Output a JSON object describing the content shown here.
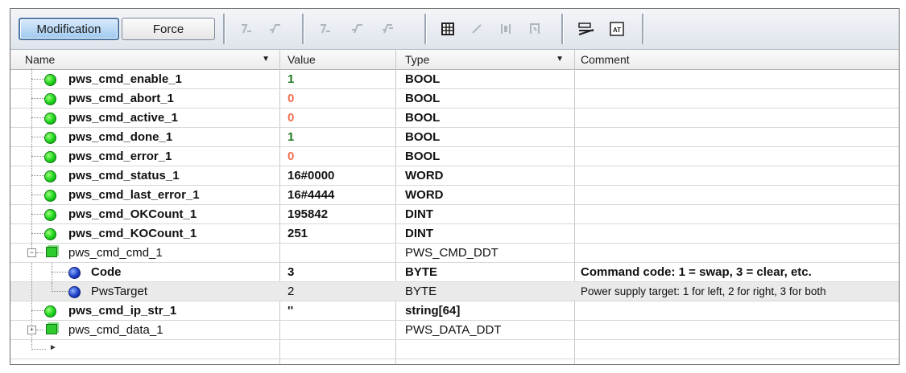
{
  "toolbar": {
    "modification_label": "Modification",
    "force_label": "Force",
    "icons": [
      "force-rising-icon",
      "force-falling-icon",
      "unforce-rising-icon",
      "unforce-falling-icon",
      "unforce-all-icon",
      "grid-icon",
      "slash-icon",
      "bracket-icon",
      "ladder-icon",
      "edit-line-icon",
      "at-icon"
    ]
  },
  "columns": {
    "name": "Name",
    "value": "Value",
    "type": "Type",
    "comment": "Comment"
  },
  "rows": [
    {
      "name": "pws_cmd_enable_1",
      "value": "1",
      "type": "BOOL",
      "comment": ""
    },
    {
      "name": "pws_cmd_abort_1",
      "value": "0",
      "type": "BOOL",
      "comment": ""
    },
    {
      "name": "pws_cmd_active_1",
      "value": "0",
      "type": "BOOL",
      "comment": ""
    },
    {
      "name": "pws_cmd_done_1",
      "value": "1",
      "type": "BOOL",
      "comment": ""
    },
    {
      "name": "pws_cmd_error_1",
      "value": "0",
      "type": "BOOL",
      "comment": ""
    },
    {
      "name": "pws_cmd_status_1",
      "value": "16#0000",
      "type": "WORD",
      "comment": ""
    },
    {
      "name": "pws_cmd_last_error_1",
      "value": "16#4444",
      "type": "WORD",
      "comment": ""
    },
    {
      "name": "pws_cmd_OKCount_1",
      "value": "195842",
      "type": "DINT",
      "comment": ""
    },
    {
      "name": "pws_cmd_KOCount_1",
      "value": "251",
      "type": "DINT",
      "comment": ""
    },
    {
      "name": "pws_cmd_cmd_1",
      "value": "",
      "type": "PWS_CMD_DDT",
      "comment": ""
    },
    {
      "name": "Code",
      "value": "3",
      "type": "BYTE",
      "comment": "Command code: 1 = swap, 3 = clear, etc."
    },
    {
      "name": "PwsTarget",
      "value": "2",
      "type": "BYTE",
      "comment": "Power supply target: 1 for left, 2 for right, 3 for both"
    },
    {
      "name": "pws_cmd_ip_str_1",
      "value": "''",
      "type": "string[64]",
      "comment": ""
    },
    {
      "name": "pws_cmd_data_1",
      "value": "",
      "type": "PWS_DATA_DDT",
      "comment": ""
    }
  ],
  "colors": {
    "true_value": "#1f7a1f",
    "false_value": "#f07050",
    "active_dot": "#19d21a",
    "member_dot": "#1e40c8",
    "selected_row": "#eaeaea"
  }
}
